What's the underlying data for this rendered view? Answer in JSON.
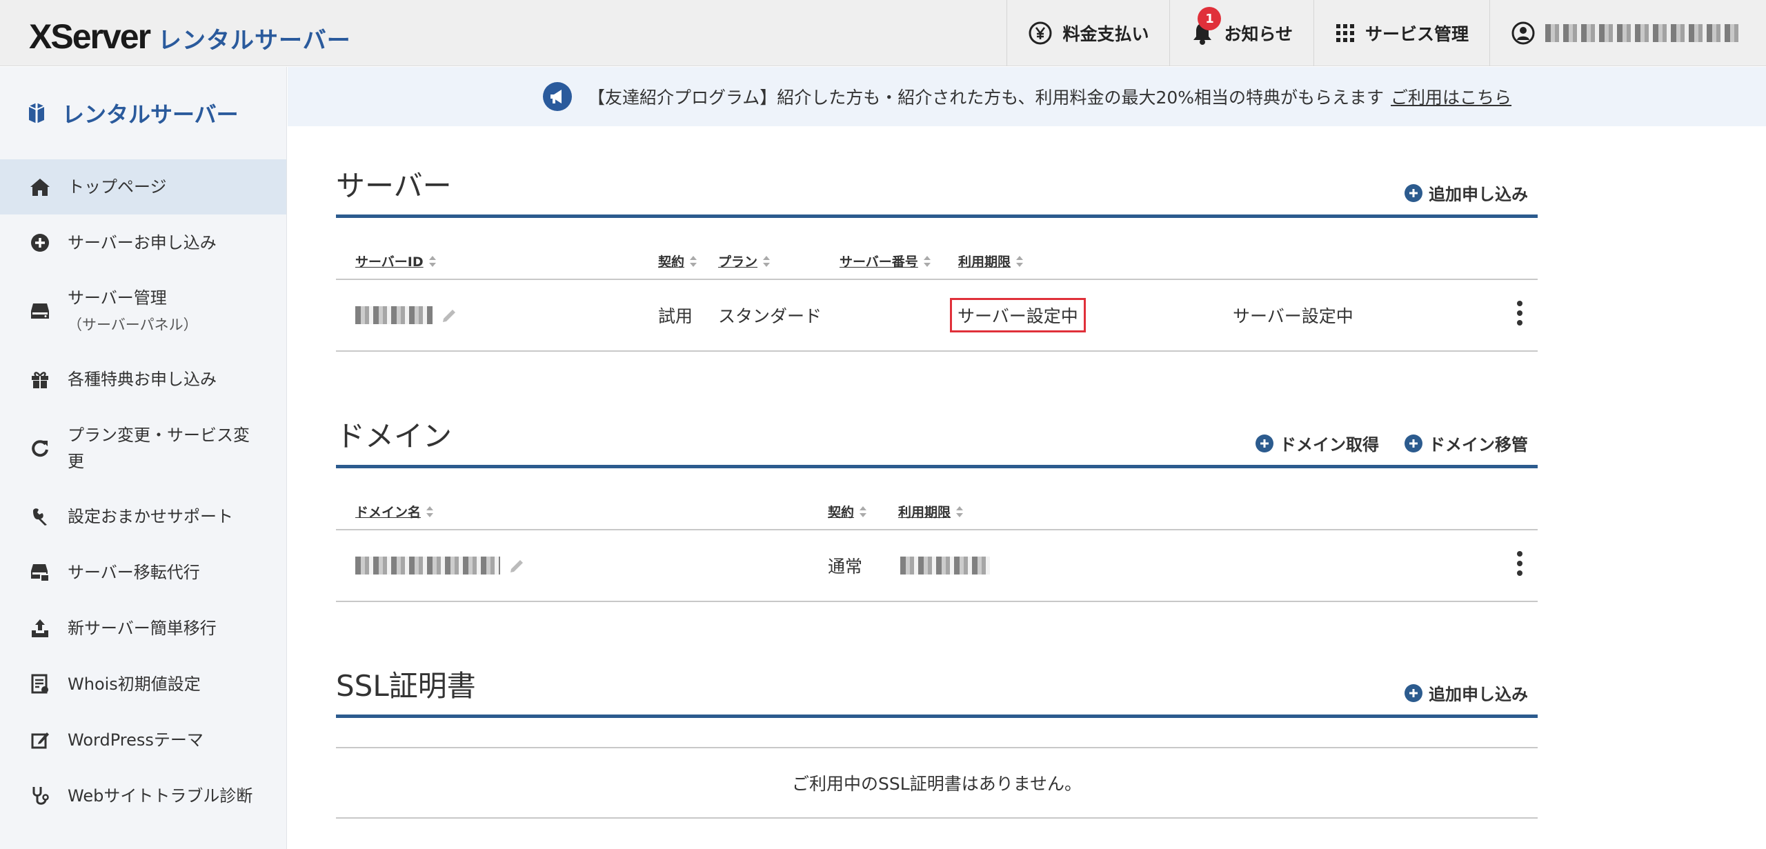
{
  "header": {
    "logo_main": "XServer",
    "logo_sub": "レンタルサーバー",
    "nav": [
      {
        "label": "料金支払い",
        "icon": "yen-icon"
      },
      {
        "label": "お知らせ",
        "icon": "bell-icon",
        "badge": "1"
      },
      {
        "label": "サービス管理",
        "icon": "grid-icon"
      }
    ],
    "account_icon": "user-icon"
  },
  "sidebar": {
    "title": "レンタルサーバー",
    "items": [
      {
        "label": "トップページ",
        "icon": "home-icon"
      },
      {
        "label": "サーバーお申し込み",
        "icon": "plus-circle-icon"
      },
      {
        "label": "サーバー管理",
        "sub": "（サーバーパネル）",
        "icon": "server-icon"
      },
      {
        "label": "各種特典お申し込み",
        "icon": "gift-icon"
      },
      {
        "label": "プラン変更・サービス変更",
        "icon": "refresh-icon"
      },
      {
        "label": "設定おまかせサポート",
        "icon": "wrench-icon"
      },
      {
        "label": "サーバー移転代行",
        "icon": "server-move-icon"
      },
      {
        "label": "新サーバー簡単移行",
        "icon": "upload-icon"
      },
      {
        "label": "Whois初期値設定",
        "icon": "document-icon"
      },
      {
        "label": "WordPressテーマ",
        "icon": "edit-icon"
      },
      {
        "label": "Webサイトトラブル診断",
        "icon": "stethoscope-icon"
      }
    ]
  },
  "banner": {
    "text": "【友達紹介プログラム】紹介した方も・紹介された方も、利用料金の最大20%相当の特典がもらえます",
    "link": "ご利用はこちら"
  },
  "server_section": {
    "title": "サーバー",
    "action": "追加申し込み",
    "columns": [
      "サーバーID",
      "契約",
      "プラン",
      "サーバー番号",
      "利用期限"
    ],
    "row": {
      "contract": "試用",
      "plan": "スタンダード",
      "expiry": "サーバー設定中",
      "status": "サーバー設定中"
    }
  },
  "domain_section": {
    "title": "ドメイン",
    "actions": [
      "ドメイン取得",
      "ドメイン移管"
    ],
    "columns": [
      "ドメイン名",
      "契約",
      "利用期限"
    ],
    "row": {
      "contract": "通常"
    }
  },
  "ssl_section": {
    "title": "SSL証明書",
    "action": "追加申し込み",
    "empty_text": "ご利用中のSSL証明書はありません。"
  }
}
